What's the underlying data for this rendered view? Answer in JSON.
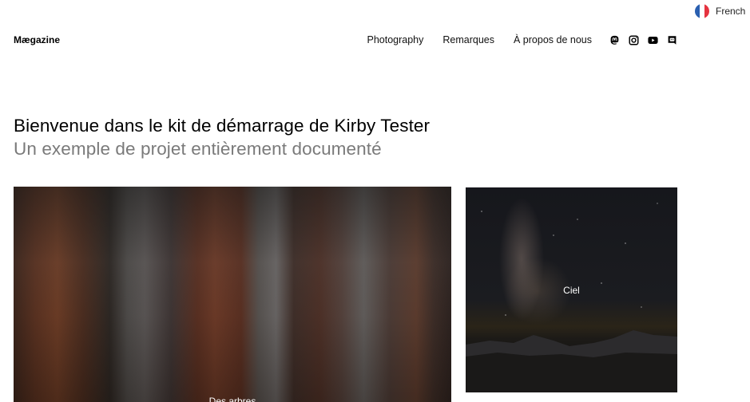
{
  "language": {
    "label": "French",
    "flag_colors": [
      "#2a5fb0",
      "#ffffff",
      "#e53340"
    ]
  },
  "header": {
    "logo": "Mægazine",
    "nav": [
      {
        "label": "Photography"
      },
      {
        "label": "Remarques"
      },
      {
        "label": "À propos de nous"
      }
    ],
    "social": [
      {
        "icon": "mastodon-icon"
      },
      {
        "icon": "instagram-icon"
      },
      {
        "icon": "youtube-icon"
      },
      {
        "icon": "discord-icon"
      }
    ]
  },
  "intro": {
    "title": "Bienvenue dans le kit de démarrage de Kirby Tester",
    "subtitle": "Un exemple de projet entièrement documenté"
  },
  "gallery": [
    {
      "caption": "Des arbres",
      "image": "redwood forest in fog"
    },
    {
      "caption": "Ciel",
      "image": "milky way over mountains"
    }
  ]
}
